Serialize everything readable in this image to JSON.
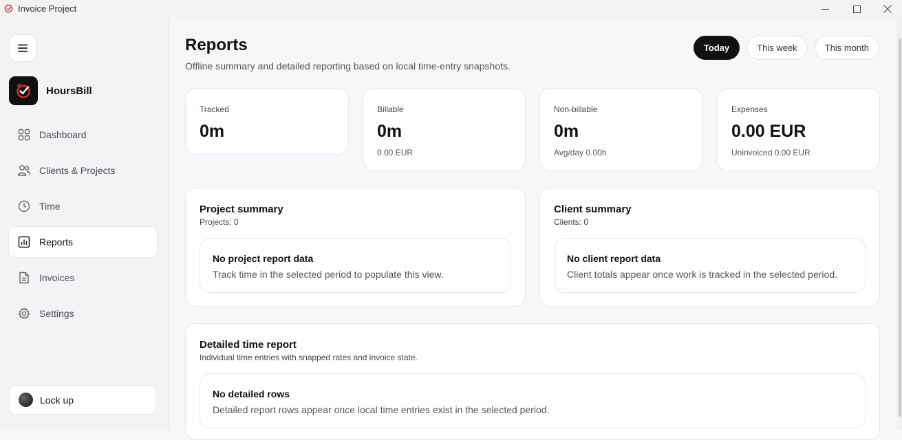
{
  "window": {
    "title": "Invoice Project"
  },
  "sidebar": {
    "brand": "HoursBill",
    "items": [
      {
        "label": "Dashboard",
        "icon": "grid-icon"
      },
      {
        "label": "Clients & Projects",
        "icon": "users-icon"
      },
      {
        "label": "Time",
        "icon": "clock-icon"
      },
      {
        "label": "Reports",
        "icon": "bar-chart-icon",
        "active": true
      },
      {
        "label": "Invoices",
        "icon": "document-icon"
      },
      {
        "label": "Settings",
        "icon": "gear-icon"
      }
    ],
    "lock_label": "Lock up"
  },
  "header": {
    "title": "Reports",
    "subtitle": "Offline summary and detailed reporting based on local time-entry snapshots.",
    "ranges": [
      "Today",
      "This week",
      "This month"
    ],
    "active_range": "Today"
  },
  "stats": [
    {
      "label": "Tracked",
      "value": "0m",
      "sub": ""
    },
    {
      "label": "Billable",
      "value": "0m",
      "sub": "0.00 EUR"
    },
    {
      "label": "Non-billable",
      "value": "0m",
      "sub": "Avg/day 0.00h"
    },
    {
      "label": "Expenses",
      "value": "0.00 EUR",
      "sub": "Uninvoiced 0.00 EUR"
    }
  ],
  "project_summary": {
    "title": "Project summary",
    "count": "Projects: 0",
    "empty_title": "No project report data",
    "empty_desc": "Track time in the selected period to populate this view."
  },
  "client_summary": {
    "title": "Client summary",
    "count": "Clients: 0",
    "empty_title": "No client report data",
    "empty_desc": "Client totals appear once work is tracked in the selected period."
  },
  "detailed_report": {
    "title": "Detailed time report",
    "subtitle": "Individual time entries with snapped rates and invoice state.",
    "empty_title": "No detailed rows",
    "empty_desc": "Detailed report rows appear once local time entries exist in the selected period."
  },
  "colors": {
    "accent": "#111111",
    "brand_mark": "#e5322d",
    "background": "#f7f7f9"
  }
}
